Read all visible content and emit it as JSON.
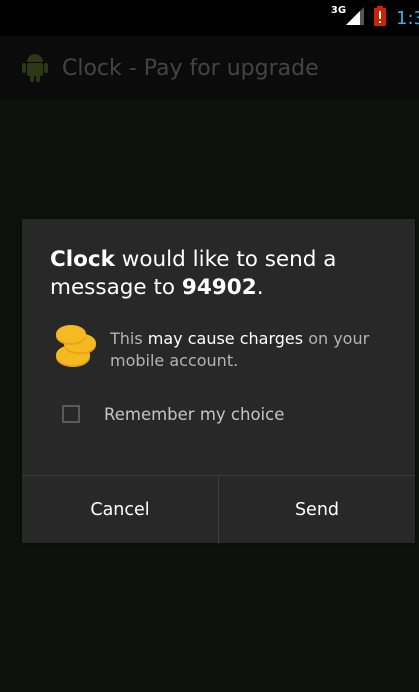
{
  "status_bar": {
    "network_type": "3G",
    "time": "1:3",
    "time_color": "#33b5e5",
    "battery_color": "#cc2200",
    "icons": [
      "signal-icon",
      "battery-alert-icon"
    ]
  },
  "action_bar": {
    "title": "Clock - Pay for upgrade",
    "icon": "android-app-icon"
  },
  "dialog": {
    "title": {
      "app_name": "Clock",
      "text1": " would like to send a message to ",
      "number": "94902",
      "text2": "."
    },
    "charges": {
      "icon": "coins-icon",
      "part1": "This ",
      "part2": "may cause charges",
      "part3": " on your mobile account."
    },
    "remember": {
      "label": "Remember my choice",
      "checked": false
    },
    "buttons": {
      "cancel": "Cancel",
      "send": "Send"
    }
  }
}
